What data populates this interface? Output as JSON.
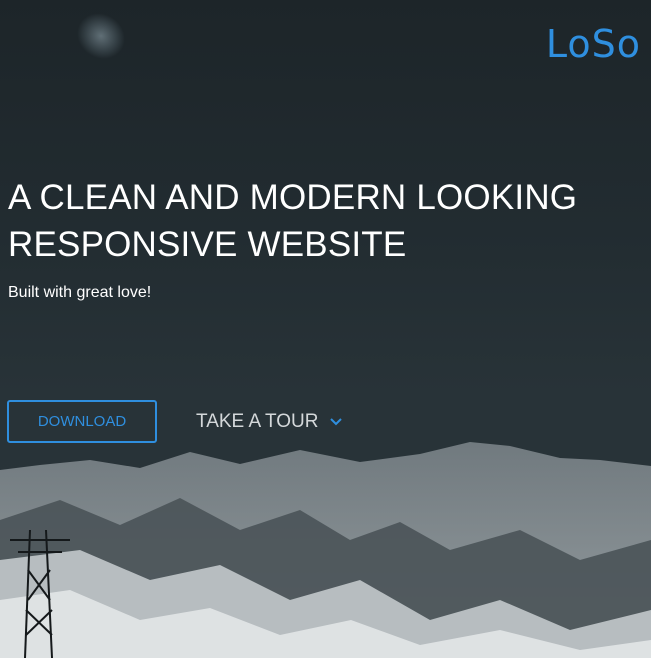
{
  "brand": {
    "logo_text": "LoSo",
    "accent_color": "#2f8fdf"
  },
  "hero": {
    "headline_line1": "A CLEAN AND MODERN LOOKING",
    "headline_line2": "RESPONSIVE WEBSITE",
    "subtitle": "Built with great love!",
    "download_label": "DOWNLOAD",
    "tour_label": "TAKE A TOUR",
    "tour_icon": "chevron-down-icon"
  }
}
